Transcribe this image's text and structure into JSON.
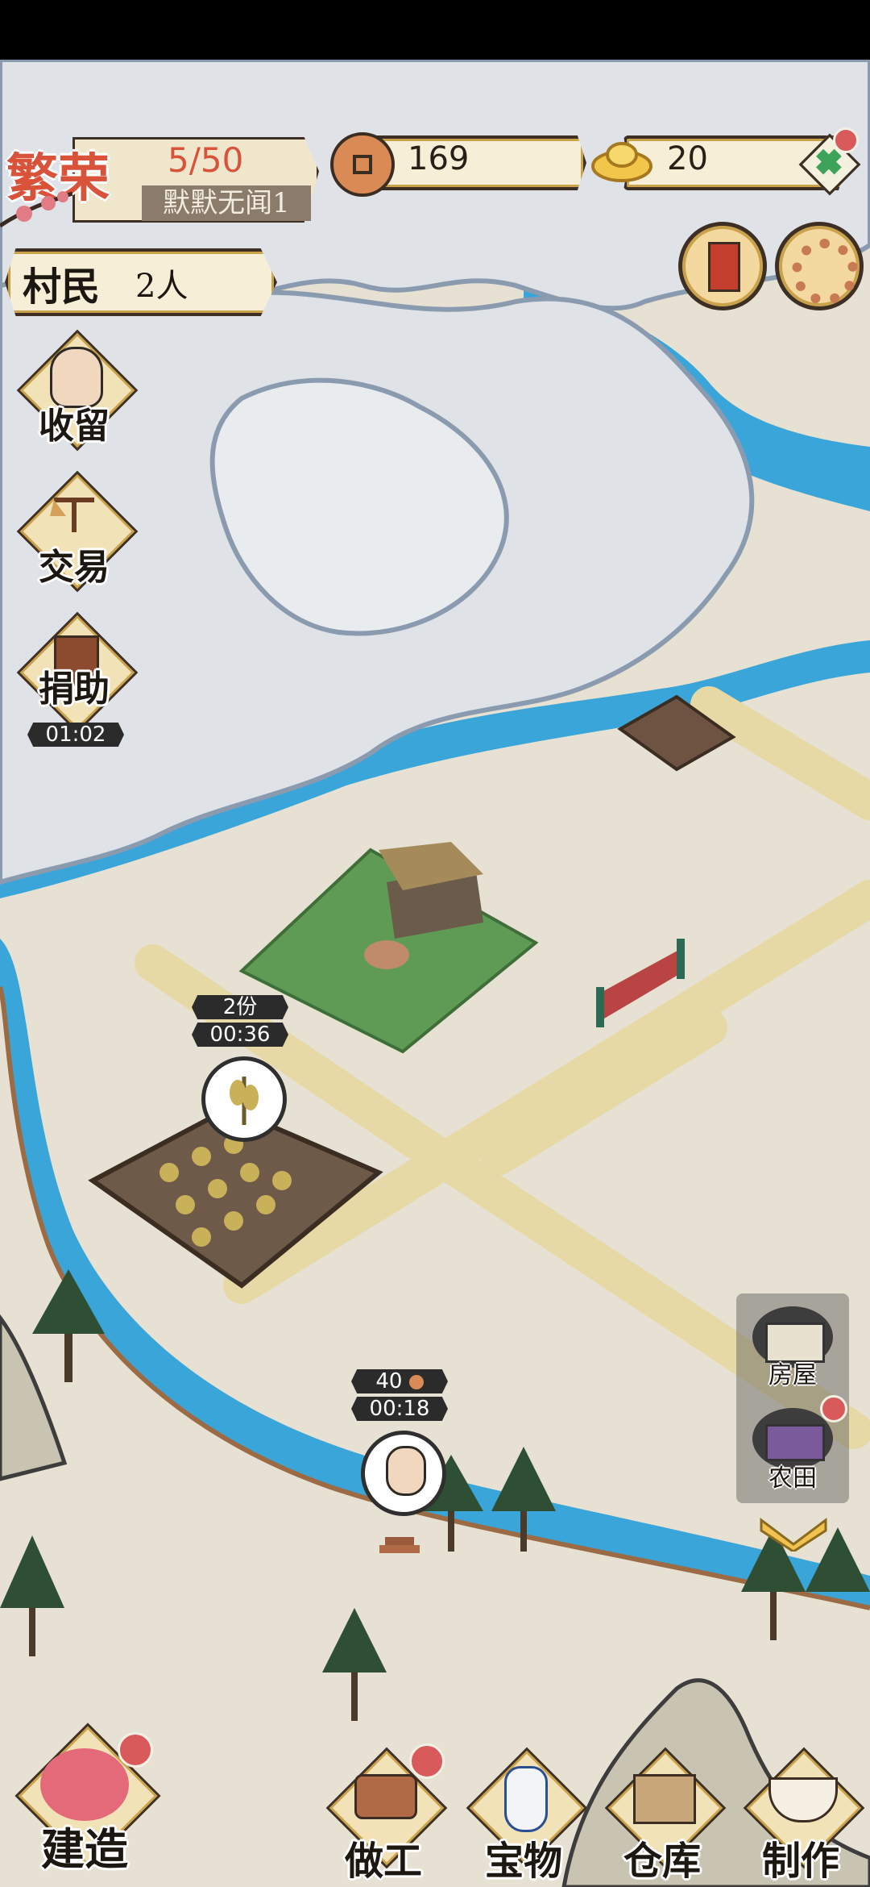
{
  "hud": {
    "prosperity_title": "繁荣",
    "prosperity_count": "5/50",
    "player_name": "默默无闻1",
    "copper": "169",
    "gold": "20",
    "villagers_label": "村民",
    "villagers_count": "2人"
  },
  "side_menu": {
    "recruit": "收留",
    "trade": "交易",
    "donate": "捐助",
    "donate_timer": "01:02"
  },
  "map": {
    "farm_yield": "2份",
    "farm_timer": "00:36",
    "worker_reward": "40",
    "worker_timer": "00:18"
  },
  "build_panel": {
    "house": "房屋",
    "farmland": "农田"
  },
  "bottom_bar": {
    "build": "建造",
    "work": "做工",
    "treasure": "宝物",
    "warehouse": "仓库",
    "craft": "制作"
  },
  "colors": {
    "water": "#3aa5d8",
    "grass": "#5f9b55",
    "path": "#e6d9a6",
    "accent_gold": "#caa24b",
    "badge_red": "#d95a5a"
  }
}
